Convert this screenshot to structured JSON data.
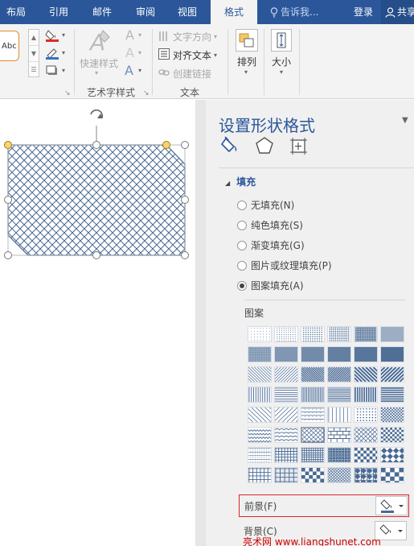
{
  "tabs": [
    {
      "label": "布局",
      "active": false
    },
    {
      "label": "引用",
      "active": false
    },
    {
      "label": "邮件",
      "active": false
    },
    {
      "label": "审阅",
      "active": false
    },
    {
      "label": "视图",
      "active": false
    },
    {
      "label": "格式",
      "active": true
    }
  ],
  "tell_me": "告诉我...",
  "login": "登录",
  "share": "共享",
  "ribbon": {
    "style_sample": "Abc",
    "quick_styles": "快速样式",
    "wordart_group": "艺术字样式",
    "text_direction": "文字方向",
    "align_text": "对齐文本",
    "create_link": "创建链接",
    "text_group": "文本",
    "arrange": "排列",
    "size": "大小"
  },
  "pane": {
    "title": "设置形状格式",
    "fill_section": "填充",
    "options": [
      {
        "label": "无填充(N)",
        "checked": false
      },
      {
        "label": "纯色填充(S)",
        "checked": false
      },
      {
        "label": "渐变填充(G)",
        "checked": false
      },
      {
        "label": "图片或纹理填充(P)",
        "checked": false
      },
      {
        "label": "图案填充(A)",
        "checked": true
      }
    ],
    "pattern_label": "图案",
    "selected_pattern": "row 6, column 3",
    "foreground": "前景(F)",
    "background": "背景(C)"
  },
  "colors": {
    "accent": "#2b579a",
    "highlight": "#d9262a",
    "pattern": "#4a6a93"
  },
  "watermark": "亮术网 www.liangshunet.com"
}
